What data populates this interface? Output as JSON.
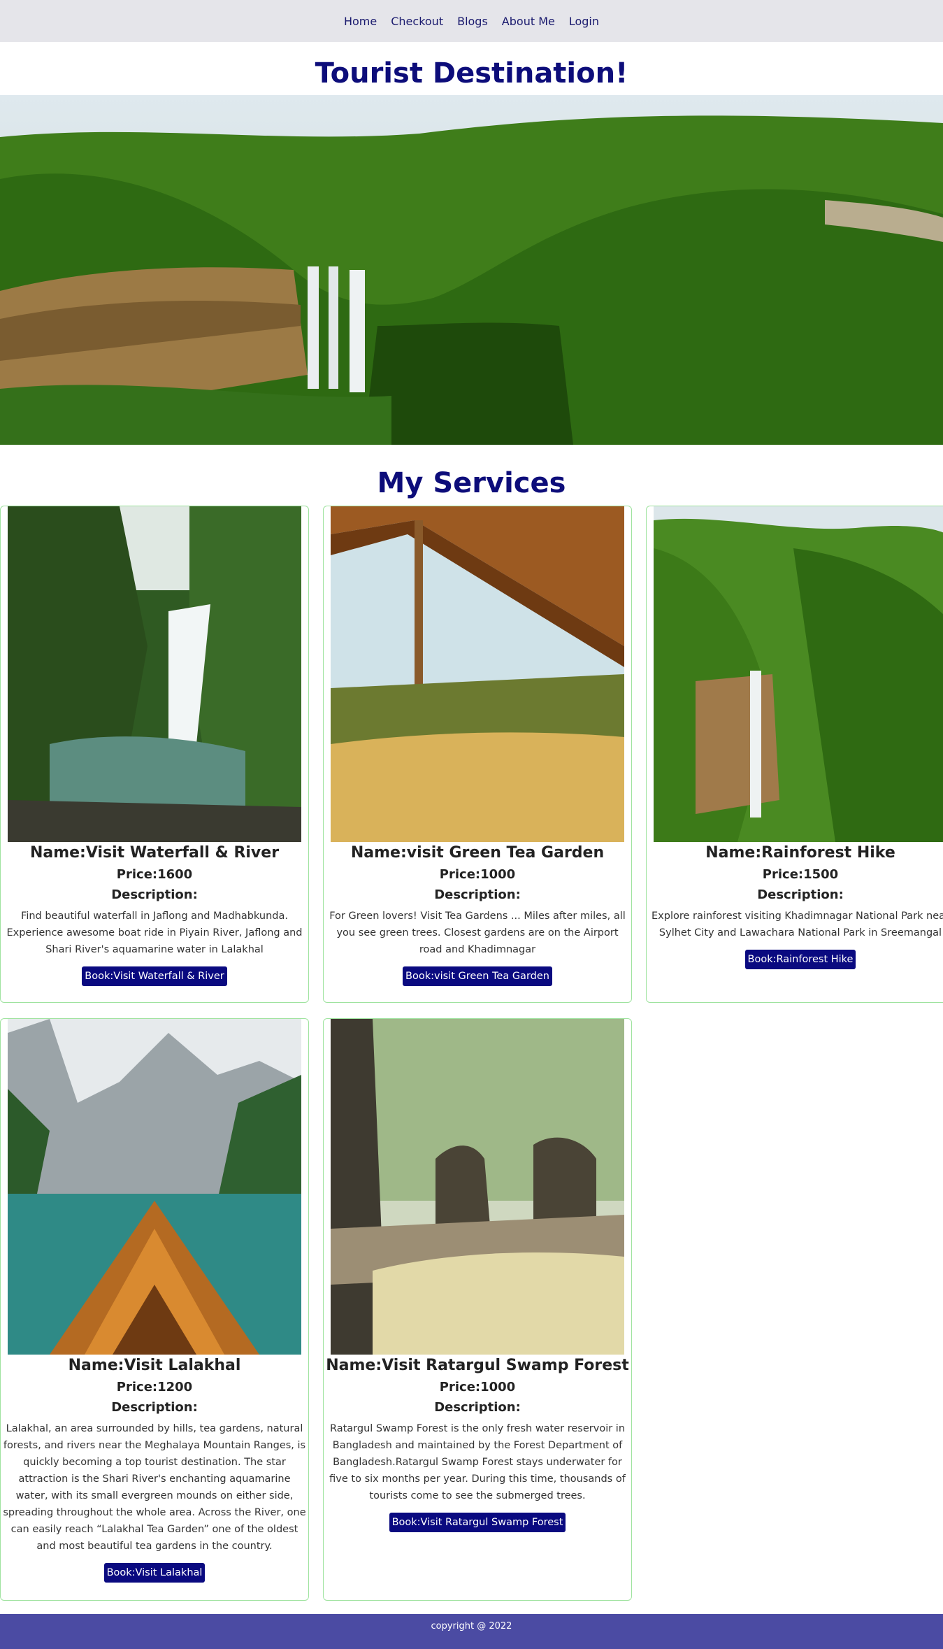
{
  "nav": {
    "items": [
      "Home",
      "Checkout",
      "Blogs",
      "About Me",
      "Login"
    ]
  },
  "site_title": "Tourist Destination!",
  "services_title": "My Services",
  "cards": [
    {
      "name": "Name:Visit Waterfall & River",
      "price": "Price:1600",
      "desc_label": "Description:",
      "description": "Find beautiful waterfall in Jaflong and Madhabkunda. Experience awesome boat ride in Piyain River, Jaflong and Shari River's aquamarine water in Lalakhal",
      "button": "Book:Visit Waterfall & River"
    },
    {
      "name": "Name:visit Green Tea Garden",
      "price": "Price:1000",
      "desc_label": "Description:",
      "description": "For Green lovers! Visit Tea Gardens ... Miles after miles, all you see green trees. Closest gardens are on the Airport road and Khadimnagar",
      "button": "Book:visit Green Tea Garden"
    },
    {
      "name": "Name:Rainforest Hike",
      "price": "Price:1500",
      "desc_label": "Description:",
      "description": "Explore rainforest visiting Khadimnagar National Park near Sylhet City and Lawachara National Park in Sreemangal",
      "button": "Book:Rainforest Hike"
    },
    {
      "name": "Name:Visit Lalakhal",
      "price": "Price:1200",
      "desc_label": "Description:",
      "description": "Lalakhal, an area surrounded by hills, tea gardens, natural forests, and rivers near the Meghalaya Mountain Ranges, is quickly becoming a top tourist destination. The star attraction is the Shari River's enchanting aquamarine water, with its small evergreen mounds on either side, spreading throughout the whole area. Across the River, one can easily reach “Lalakhal Tea Garden” one of the oldest and most beautiful tea gardens in the country.",
      "button": "Book:Visit Lalakhal"
    },
    {
      "name": "Name:Visit Ratargul Swamp Forest",
      "price": "Price:1000",
      "desc_label": "Description:",
      "description": "Ratargul Swamp Forest is the only fresh water reservoir in Bangladesh and maintained by the Forest Department of Bangladesh.Ratargul Swamp Forest stays underwater for five to six months per year. During this time, thousands of tourists come to see the submerged trees.",
      "button": "Book:Visit Ratargul Swamp Forest"
    }
  ],
  "footer": "copyright @ 2022"
}
